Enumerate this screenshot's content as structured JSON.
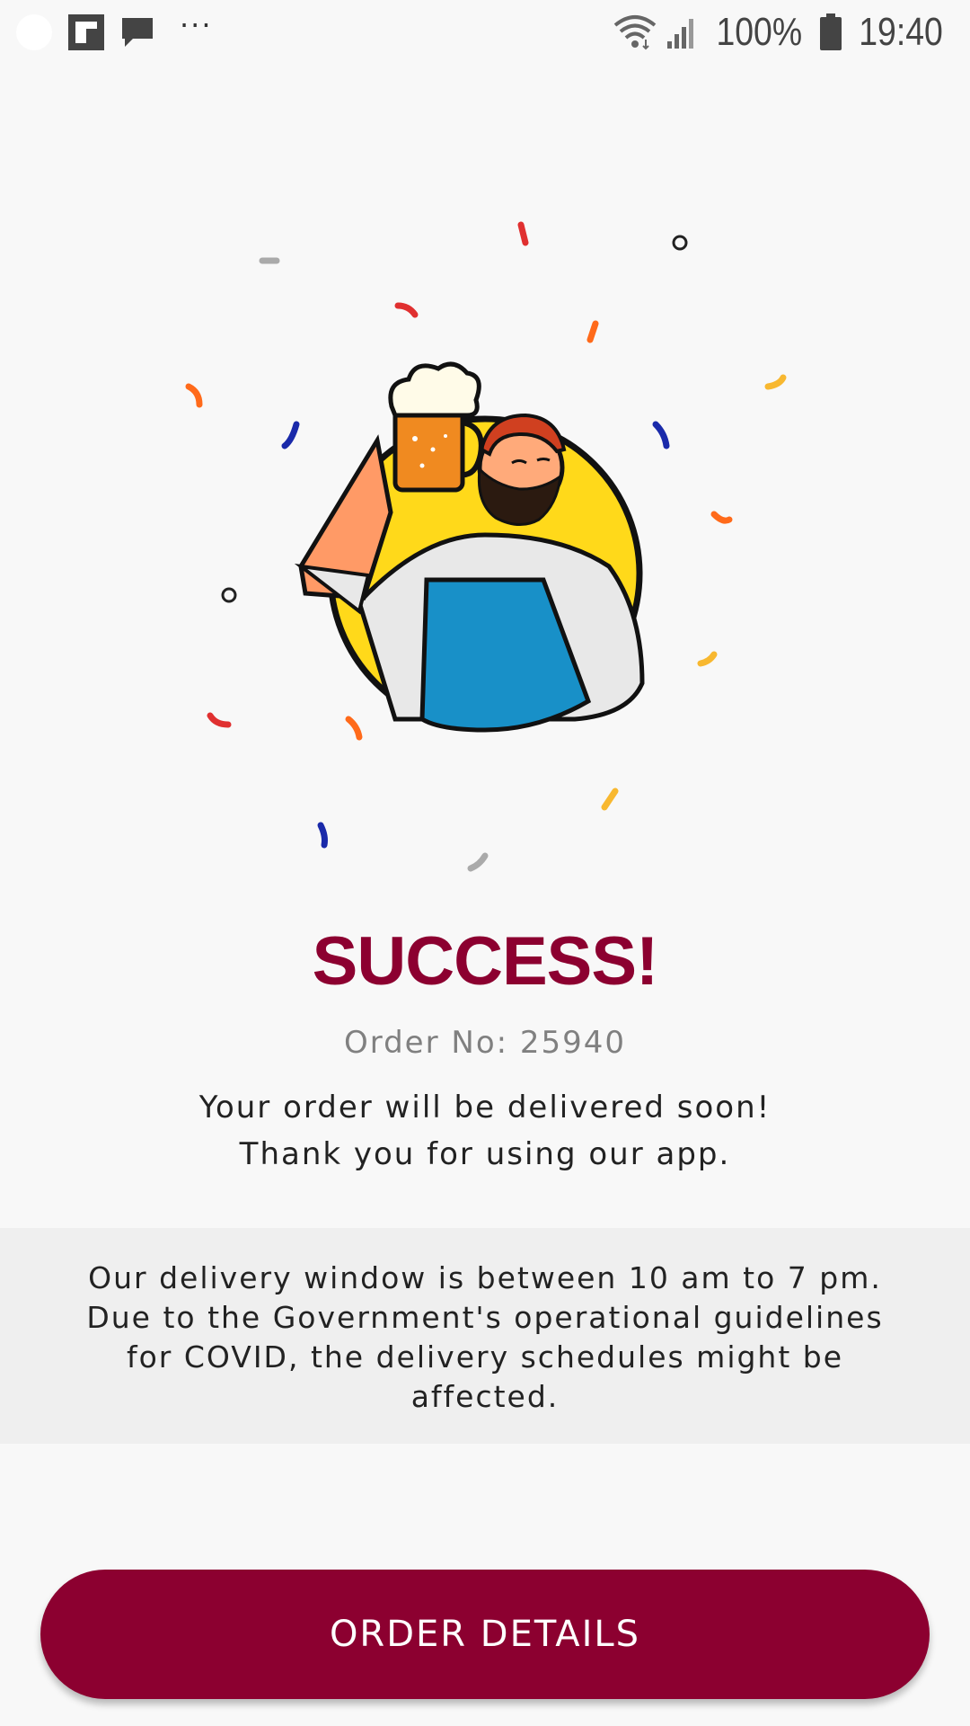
{
  "status_bar": {
    "battery_percent": "100%",
    "time": "19:40",
    "left_icons": [
      "notification-dot-icon",
      "flipboard-icon",
      "message-icon",
      "more-dots-icon"
    ],
    "right_icons": [
      "wifi-icon",
      "signal-icon",
      "battery-icon"
    ]
  },
  "success": {
    "title": "SUCCESS!",
    "order_number": "Order No: 25940",
    "message_line1": "Your order will be delivered soon!",
    "message_line2": "Thank you for using our app."
  },
  "notice": {
    "line1": "Our delivery window is between 10 am to 7 pm.",
    "line2": "Due to the Government's operational guidelines",
    "line3": "for COVID, the delivery schedules might be",
    "line4": "affected."
  },
  "button": {
    "label": "ORDER DETAILS"
  },
  "colors": {
    "brand": "#8c0030",
    "background": "#f8f8f8",
    "notice_background": "#efefef"
  }
}
